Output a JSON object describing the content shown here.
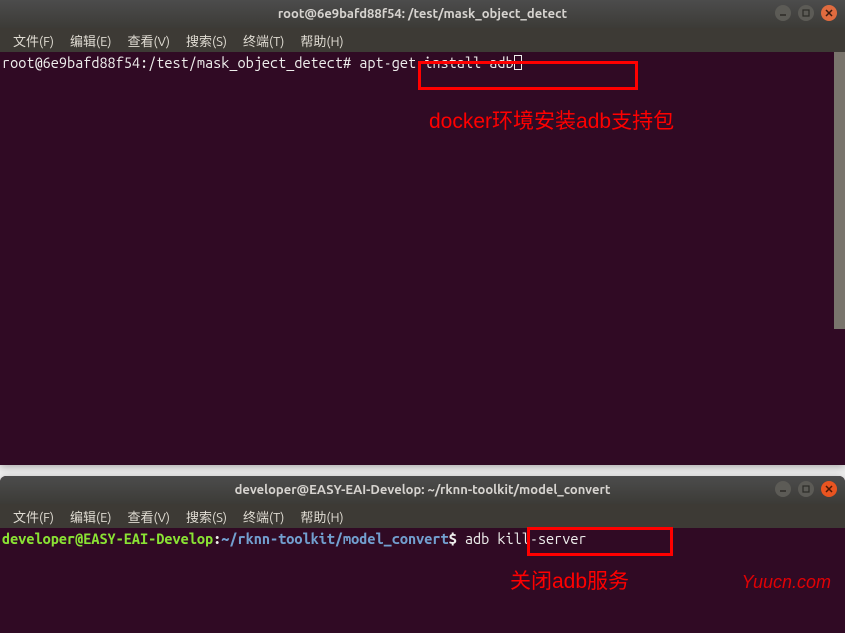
{
  "window1": {
    "title": "root@6e9bafd88f54: /test/mask_object_detect",
    "prompt": "root@6e9bafd88f54:/test/mask_object_detect# ",
    "command": "apt-get install adb"
  },
  "window2": {
    "title": "developer@EASY-EAI-Develop: ~/rknn-toolkit/model_convert",
    "prompt_user": "developer@EASY-EAI-Develop",
    "prompt_colon": ":",
    "prompt_path": "~/rknn-toolkit/model_convert",
    "prompt_dollar": "$ ",
    "command": "adb kill-server"
  },
  "menu": {
    "file": "文件(F)",
    "edit": "编辑(E)",
    "view": "查看(V)",
    "search": "搜索(S)",
    "terminal": "终端(T)",
    "help": "帮助(H)"
  },
  "annotations": {
    "a1": "docker环境安装adb支持包",
    "a2": "关闭adb服务"
  },
  "watermark": "Yuucn.com"
}
